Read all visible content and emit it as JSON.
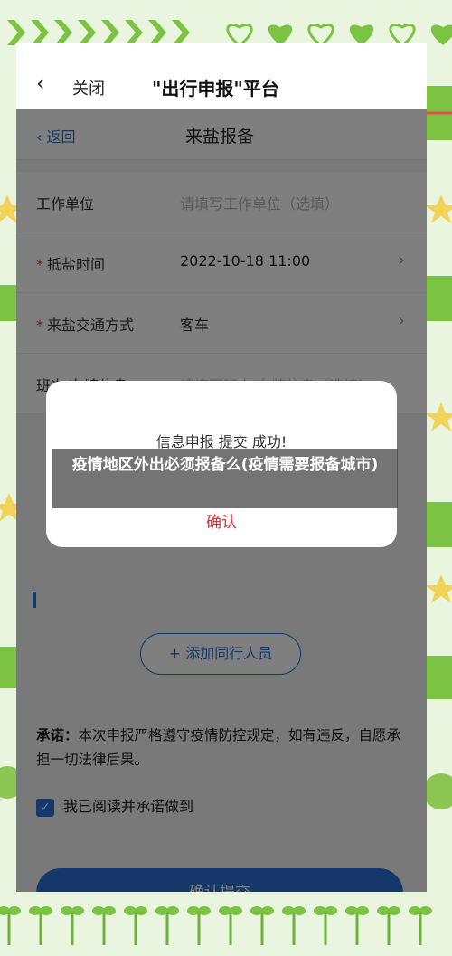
{
  "topbar": {
    "back_icon": "chevron-left",
    "close_label": "关闭",
    "title": "\"出行申报\"平台"
  },
  "subheader": {
    "back_label": "返回",
    "title": "来盐报备"
  },
  "form": {
    "work_unit": {
      "label": "工作单位",
      "placeholder": "请填写工作单位（选填）"
    },
    "arrival_time": {
      "label": "抵盐时间",
      "value": "2022-10-18 11:00"
    },
    "transport": {
      "label": "来盐交通方式",
      "value": "客车"
    },
    "vehicle": {
      "label": "班次/车牌信息",
      "placeholder": "请填写班次/车牌信息（选填）"
    }
  },
  "add_companion_label": "添加同行人员",
  "pledge": {
    "title": "承诺：",
    "text": "本次申报严格遵守疫情防控规定，如有违反，自愿承担一切法律后果。"
  },
  "agree_label": "我已阅读并承诺做到",
  "submit_label": "确认提交",
  "dialog": {
    "message": "信息申报 提交 成功!",
    "confirm_label": "确认"
  },
  "caption": "疫情地区外出必须报备么(疫情需要报备城市)",
  "colors": {
    "accent": "#2d6fd6",
    "confirm": "#e0302f",
    "required": "#e23b3b"
  }
}
